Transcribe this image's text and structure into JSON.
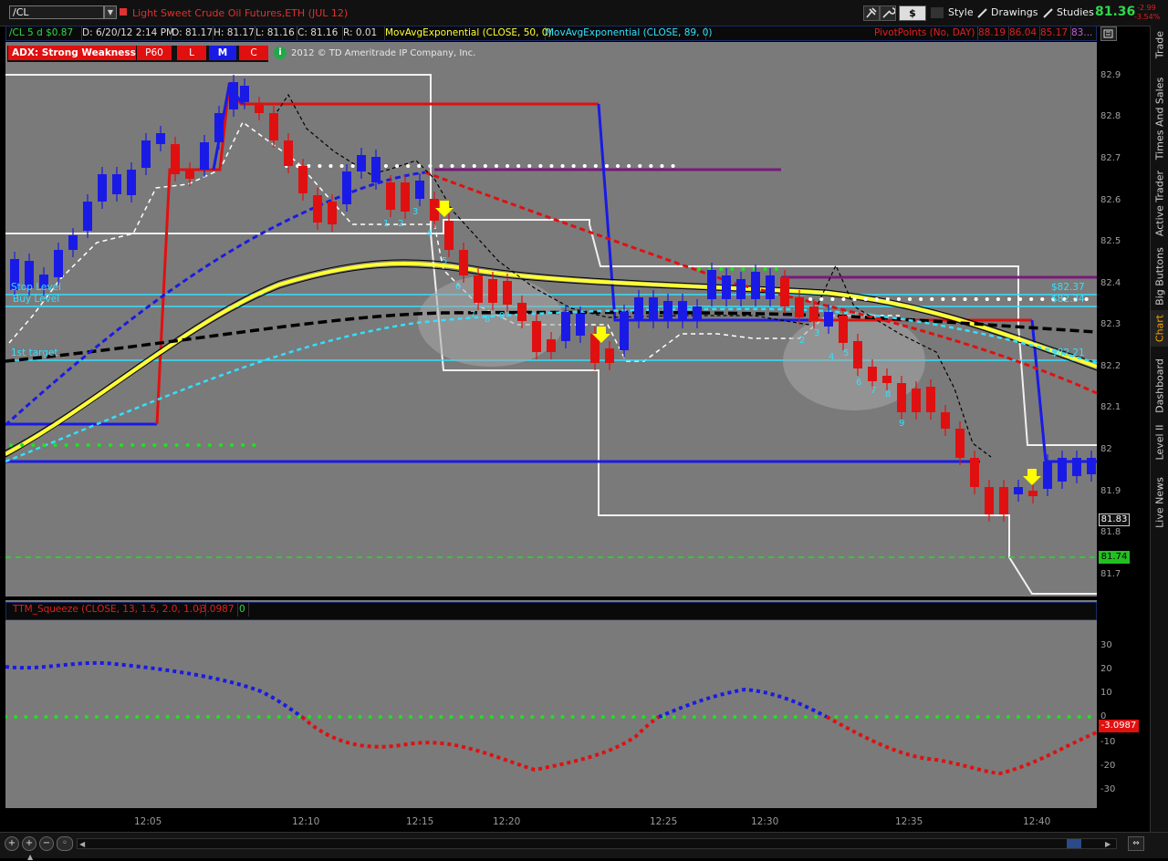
{
  "app": {
    "symbol": "/CL",
    "instrument": "Light Sweet Crude Oil Futures,ETH (JUL 12)",
    "last_price": "81.36",
    "change_abs": "-2.99",
    "change_pct": "-3.54%"
  },
  "toolbar": {
    "buttons": [
      {
        "name": "pin-icon",
        "label": ""
      },
      {
        "name": "wrench-icon",
        "label": ""
      },
      {
        "name": "dollar-button",
        "label": "$"
      },
      {
        "name": "style-button",
        "label": "Style"
      },
      {
        "name": "drawings-button",
        "label": "Drawings"
      },
      {
        "name": "studies-button",
        "label": "Studies"
      }
    ]
  },
  "info_bar": {
    "symbol_period": "/CL 5 d $0.87",
    "date": "D: 6/20/12 2:14 PM",
    "open": "O: 81.17",
    "high": "H: 81.17",
    "low": "L: 81.16",
    "close": "C: 81.16",
    "range": "R: 0.01",
    "ema50": "MovAvgExponential (CLOSE, 50, 0)",
    "ema89": "MovAvgExponential (CLOSE, 89, 0)",
    "pivot": "PivotPoints (No, DAY)",
    "pivot_values": [
      "88.19",
      "86.04",
      "85.17",
      "83..."
    ]
  },
  "study_bar": {
    "adx": "ADX:  Strong Weakness",
    "p60": "P60",
    "l": "L",
    "m": "M",
    "c": "C",
    "copyright": "2012 © TD Ameritrade IP Company, Inc."
  },
  "price_axis": {
    "labels": [
      "82.9",
      "82.8",
      "82.7",
      "82.6",
      "82.5",
      "82.4",
      "82.3",
      "82.2",
      "82.1",
      "82",
      "81.9",
      "81.8",
      "81.7"
    ],
    "marker_current": "81.83",
    "marker_green": "81.74"
  },
  "chart_labels": {
    "stop_level": "Stop Level",
    "buy_level": "Buy Level",
    "first_target": "1st target",
    "level_8237": "$82.37",
    "level_8234": "$82.34",
    "level_8221": "$82.21",
    "count_a": [
      "1",
      "2",
      "3",
      "4",
      "5",
      "6",
      "7",
      "8",
      "9"
    ],
    "count_b": [
      "2",
      "3",
      "4",
      "5",
      "6",
      "7",
      "8",
      "9"
    ]
  },
  "sub_panel": {
    "study": "TTM_Squeeze (CLOSE, 13, 1.5, 2.0, 1.0)",
    "value": "-3.0987",
    "value2": "0",
    "axis_labels": [
      "30",
      "20",
      "10",
      "0",
      "-10",
      "-20",
      "-30"
    ],
    "marker": "-3.0987"
  },
  "time_axis": {
    "labels": [
      "12:05",
      "12:10",
      "12:15",
      "12:20",
      "12:25",
      "12:30",
      "12:35",
      "12:40"
    ]
  },
  "side_tabs": [
    "Trade",
    "Times And Sales",
    "Active Trader",
    "Big Buttons",
    "Chart",
    "Dashboard",
    "Level II",
    "Live News"
  ],
  "colors": {
    "bull": "#1a1ae6",
    "bear": "#e01010",
    "ema_fast": "#ffff33",
    "ema_slow": "#000000",
    "cyan": "#33e0ff",
    "price_green": "#2fd84a"
  }
}
